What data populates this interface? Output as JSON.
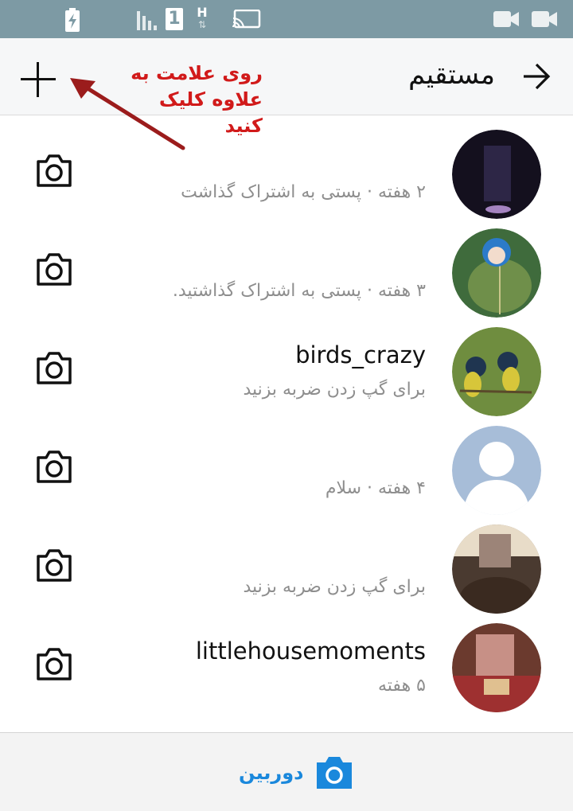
{
  "status_bar": {
    "icons": [
      "charging-battery-icon",
      "signal-icon",
      "sim-1-icon",
      "h-network-icon",
      "cast-icon",
      "video-icon",
      "video-icon"
    ],
    "sim_label": "1",
    "network_label": "H"
  },
  "header": {
    "title": "مستقیم",
    "plus_icon": "plus-icon",
    "back_icon": "arrow-right-icon"
  },
  "annotation": {
    "line1": "روی علامت به",
    "line2": "علاوه کلیک کنید",
    "color": "#d11a1a",
    "arrow_color": "#9b1c1c"
  },
  "threads": [
    {
      "name": "",
      "subtitle": "۲ هفته · پستی به اشتراک گذاشت",
      "avatar": "dark-purple-photo"
    },
    {
      "name": "",
      "subtitle": "۳ هفته · پستی به اشتراک گذاشتید.",
      "avatar": "felt-doll-photo"
    },
    {
      "name": "birds_crazy",
      "subtitle": "برای گپ زدن ضربه بزنید",
      "avatar": "green-birds-photo"
    },
    {
      "name": "",
      "subtitle": "۴ هفته · سلام",
      "avatar": "default-profile-silhouette"
    },
    {
      "name": "",
      "subtitle": "برای گپ زدن ضربه بزنید",
      "avatar": "blurred-face-photo"
    },
    {
      "name": "littlehousemoments",
      "subtitle": "۵ هفته",
      "avatar": "blurred-child-photo"
    }
  ],
  "bottom_bar": {
    "camera_label": "دوربین",
    "accent": "#1a88dc"
  }
}
